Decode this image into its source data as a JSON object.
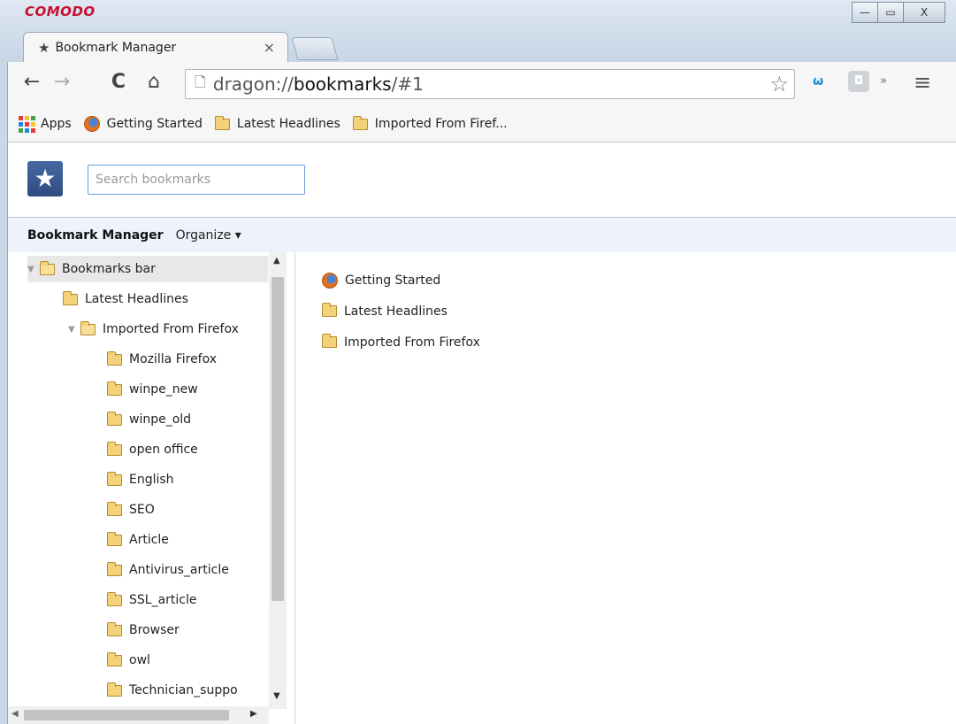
{
  "window": {
    "brand": "COMODO",
    "minimize": "—",
    "maximize": "▭",
    "close": "X"
  },
  "tab": {
    "title": "Bookmark Manager",
    "close": "×"
  },
  "toolbar": {
    "back": "←",
    "forward": "→",
    "reload": "C",
    "home": "⌂",
    "url_prefix": "dragon://",
    "url_host": "bookmarks",
    "url_path": "/#1",
    "star": "☆",
    "ext1": "ѡ",
    "ext2": "◘",
    "more": "»",
    "menu": "≡"
  },
  "bookmarks_bar": {
    "apps_label": "Apps",
    "items": [
      {
        "label": "Getting Started",
        "icon": "firefox-icon"
      },
      {
        "label": "Latest Headlines",
        "icon": "folder-icon"
      },
      {
        "label": "Imported From Firef...",
        "icon": "folder-icon"
      }
    ]
  },
  "search": {
    "placeholder": "Search bookmarks"
  },
  "header": {
    "title": "Bookmark Manager",
    "organize": "Organize ▾"
  },
  "tree": [
    {
      "label": "Bookmarks bar",
      "open": true
    },
    {
      "label": "Latest Headlines"
    },
    {
      "label": "Imported From Firefox",
      "open": true
    },
    {
      "label": "Mozilla Firefox"
    },
    {
      "label": "winpe_new"
    },
    {
      "label": "winpe_old"
    },
    {
      "label": "open office"
    },
    {
      "label": "English"
    },
    {
      "label": "SEO"
    },
    {
      "label": "Article"
    },
    {
      "label": "Antivirus_article"
    },
    {
      "label": "SSL_article"
    },
    {
      "label": "Browser"
    },
    {
      "label": "owl"
    },
    {
      "label": "Technician_suppo"
    }
  ],
  "list": [
    {
      "label": "Getting Started",
      "icon": "firefox-icon"
    },
    {
      "label": "Latest Headlines",
      "icon": "folder-icon"
    },
    {
      "label": "Imported From Firefox",
      "icon": "folder-icon"
    }
  ],
  "colors": {
    "brand": "#c8102e",
    "header_bar": "#edf2fb",
    "folder": "#f3d27a",
    "apps_grid": [
      "#e53935",
      "#fbc02d",
      "#43a047",
      "#1e88e5",
      "#e53935",
      "#fbc02d",
      "#43a047",
      "#1e88e5",
      "#e53935"
    ]
  }
}
